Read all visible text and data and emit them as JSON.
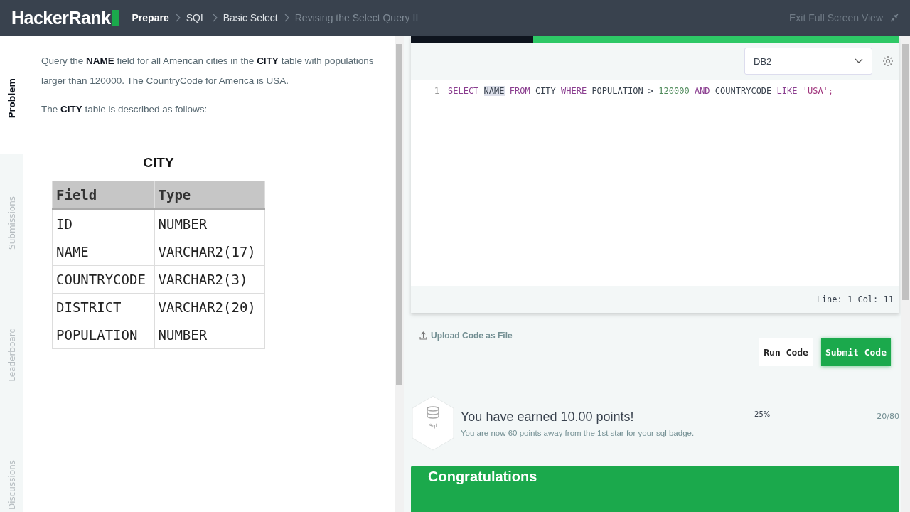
{
  "header": {
    "logo": "HackerRank",
    "breadcrumbs": [
      {
        "label": "Prepare",
        "current": false
      },
      {
        "label": "SQL",
        "current": false
      },
      {
        "label": "Basic Select",
        "current": false
      },
      {
        "label": "Revising the Select Query II",
        "current": true
      }
    ],
    "exit_link": "Exit Full Screen View"
  },
  "side_tabs": [
    {
      "label": "Problem",
      "selected": true
    },
    {
      "label": "Submissions",
      "selected": false
    },
    {
      "label": "Leaderboard",
      "selected": false
    },
    {
      "label": "Discussions",
      "selected": false
    }
  ],
  "problem": {
    "paragraphs": [
      "Query the **NAME** field for all American cities in the **CITY** table with populations larger than 120000. The CountryCode for America is USA.",
      "The **CITY** table is described as follows:"
    ],
    "table_title": "CITY",
    "columns": [
      "Field",
      "Type"
    ],
    "rows": [
      [
        "ID",
        "NUMBER"
      ],
      [
        "NAME",
        "VARCHAR2(17)"
      ],
      [
        "COUNTRYCODE",
        "VARCHAR2(3)"
      ],
      [
        "DISTRICT",
        "VARCHAR2(20)"
      ],
      [
        "POPULATION",
        "NUMBER"
      ]
    ]
  },
  "editor": {
    "language": "DB2",
    "line_number": "1",
    "tokens": [
      {
        "text": "SELECT",
        "kind": "keyword",
        "highlighted": false
      },
      {
        "text": "NAME",
        "kind": "ident",
        "highlighted": true
      },
      {
        "text": "FROM",
        "kind": "keyword",
        "highlighted": false
      },
      {
        "text": "CITY",
        "kind": "ident",
        "highlighted": false
      },
      {
        "text": "WHERE",
        "kind": "keyword",
        "highlighted": false
      },
      {
        "text": "POPULATION",
        "kind": "ident",
        "highlighted": false
      },
      {
        "text": ">",
        "kind": "op",
        "highlighted": false
      },
      {
        "text": "120000",
        "kind": "number",
        "highlighted": false
      },
      {
        "text": "AND",
        "kind": "keyword",
        "highlighted": false
      },
      {
        "text": "COUNTRYCODE",
        "kind": "ident",
        "highlighted": false
      },
      {
        "text": "LIKE",
        "kind": "keyword",
        "highlighted": false
      },
      {
        "text": "'USA';",
        "kind": "string",
        "highlighted": false
      }
    ],
    "status": "Line: 1 Col: 11"
  },
  "actions": {
    "upload": "Upload Code as File",
    "run": "Run Code",
    "submit": "Submit Code"
  },
  "result": {
    "badge_label": "Sql",
    "title": "You have earned 10.00 points!",
    "message": "You are now 60 points away from the 1st star for your sql badge.",
    "percent": "25%",
    "progress": "20/80",
    "banner": "Congratulations"
  }
}
